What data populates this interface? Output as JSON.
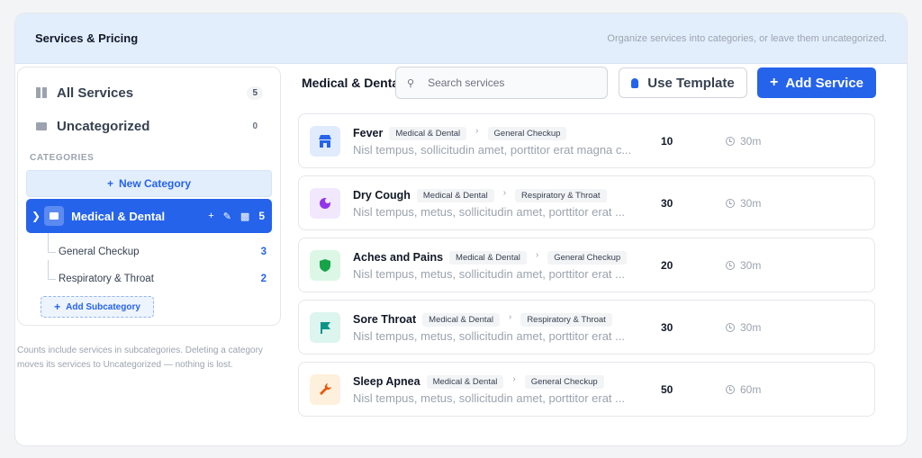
{
  "header": {
    "title": "Services & Pricing",
    "subtitle": "Organize services into categories, or leave them uncategorized."
  },
  "sidebar": {
    "all_services": {
      "label": "All Services",
      "count": "5"
    },
    "uncategorized": {
      "label": "Uncategorized",
      "count": "0"
    },
    "categories_label": "CATEGORIES",
    "new_category": "New Category",
    "selected_category": {
      "label": "Medical & Dental",
      "count": "5"
    },
    "subcategories": [
      {
        "label": "General Checkup",
        "count": "3"
      },
      {
        "label": "Respiratory & Throat",
        "count": "2"
      }
    ],
    "add_subcategory": "Add Subcategory",
    "note": "Counts include services in subcategories. Deleting a category moves its services to Uncategorized — nothing is lost."
  },
  "main": {
    "category_title": "Medical & Dental",
    "search_placeholder": "Search services",
    "use_template": "Use Template",
    "add_service": "Add Service",
    "services": [
      {
        "name": "Fever",
        "category": "Medical & Dental",
        "subcategory": "General Checkup",
        "description": "Nisl tempus, sollicitudin amet, porttitor erat magna c...",
        "price": "10",
        "duration": "30m",
        "icon": "store-icon",
        "icon_bg": "#e0ecfd",
        "icon_color": "#2563eb"
      },
      {
        "name": "Dry Cough",
        "category": "Medical & Dental",
        "subcategory": "Respiratory & Throat",
        "description": "Nisl tempus, metus, sollicitudin amet, porttitor erat ...",
        "price": "30",
        "duration": "30m",
        "icon": "moon-icon",
        "icon_bg": "#f1e8fd",
        "icon_color": "#9333ea"
      },
      {
        "name": "Aches and Pains",
        "category": "Medical & Dental",
        "subcategory": "General Checkup",
        "description": "Nisl tempus, metus, sollicitudin amet, porttitor erat ...",
        "price": "20",
        "duration": "30m",
        "icon": "shield-icon",
        "icon_bg": "#dcf7e6",
        "icon_color": "#16a34a"
      },
      {
        "name": "Sore Throat",
        "category": "Medical & Dental",
        "subcategory": "Respiratory & Throat",
        "description": "Nisl tempus, metus, sollicitudin amet, porttitor erat ...",
        "price": "30",
        "duration": "30m",
        "icon": "flag-icon",
        "icon_bg": "#dcf5ee",
        "icon_color": "#0d9488"
      },
      {
        "name": "Sleep Apnea",
        "category": "Medical & Dental",
        "subcategory": "General Checkup",
        "description": "Nisl tempus, metus, sollicitudin amet, porttitor erat ...",
        "price": "50",
        "duration": "60m",
        "icon": "wrench-icon",
        "icon_bg": "#fdf0dc",
        "icon_color": "#ea580c"
      }
    ]
  },
  "colors": {
    "accent": "#2563eb",
    "header_bg": "#e3eefc"
  }
}
